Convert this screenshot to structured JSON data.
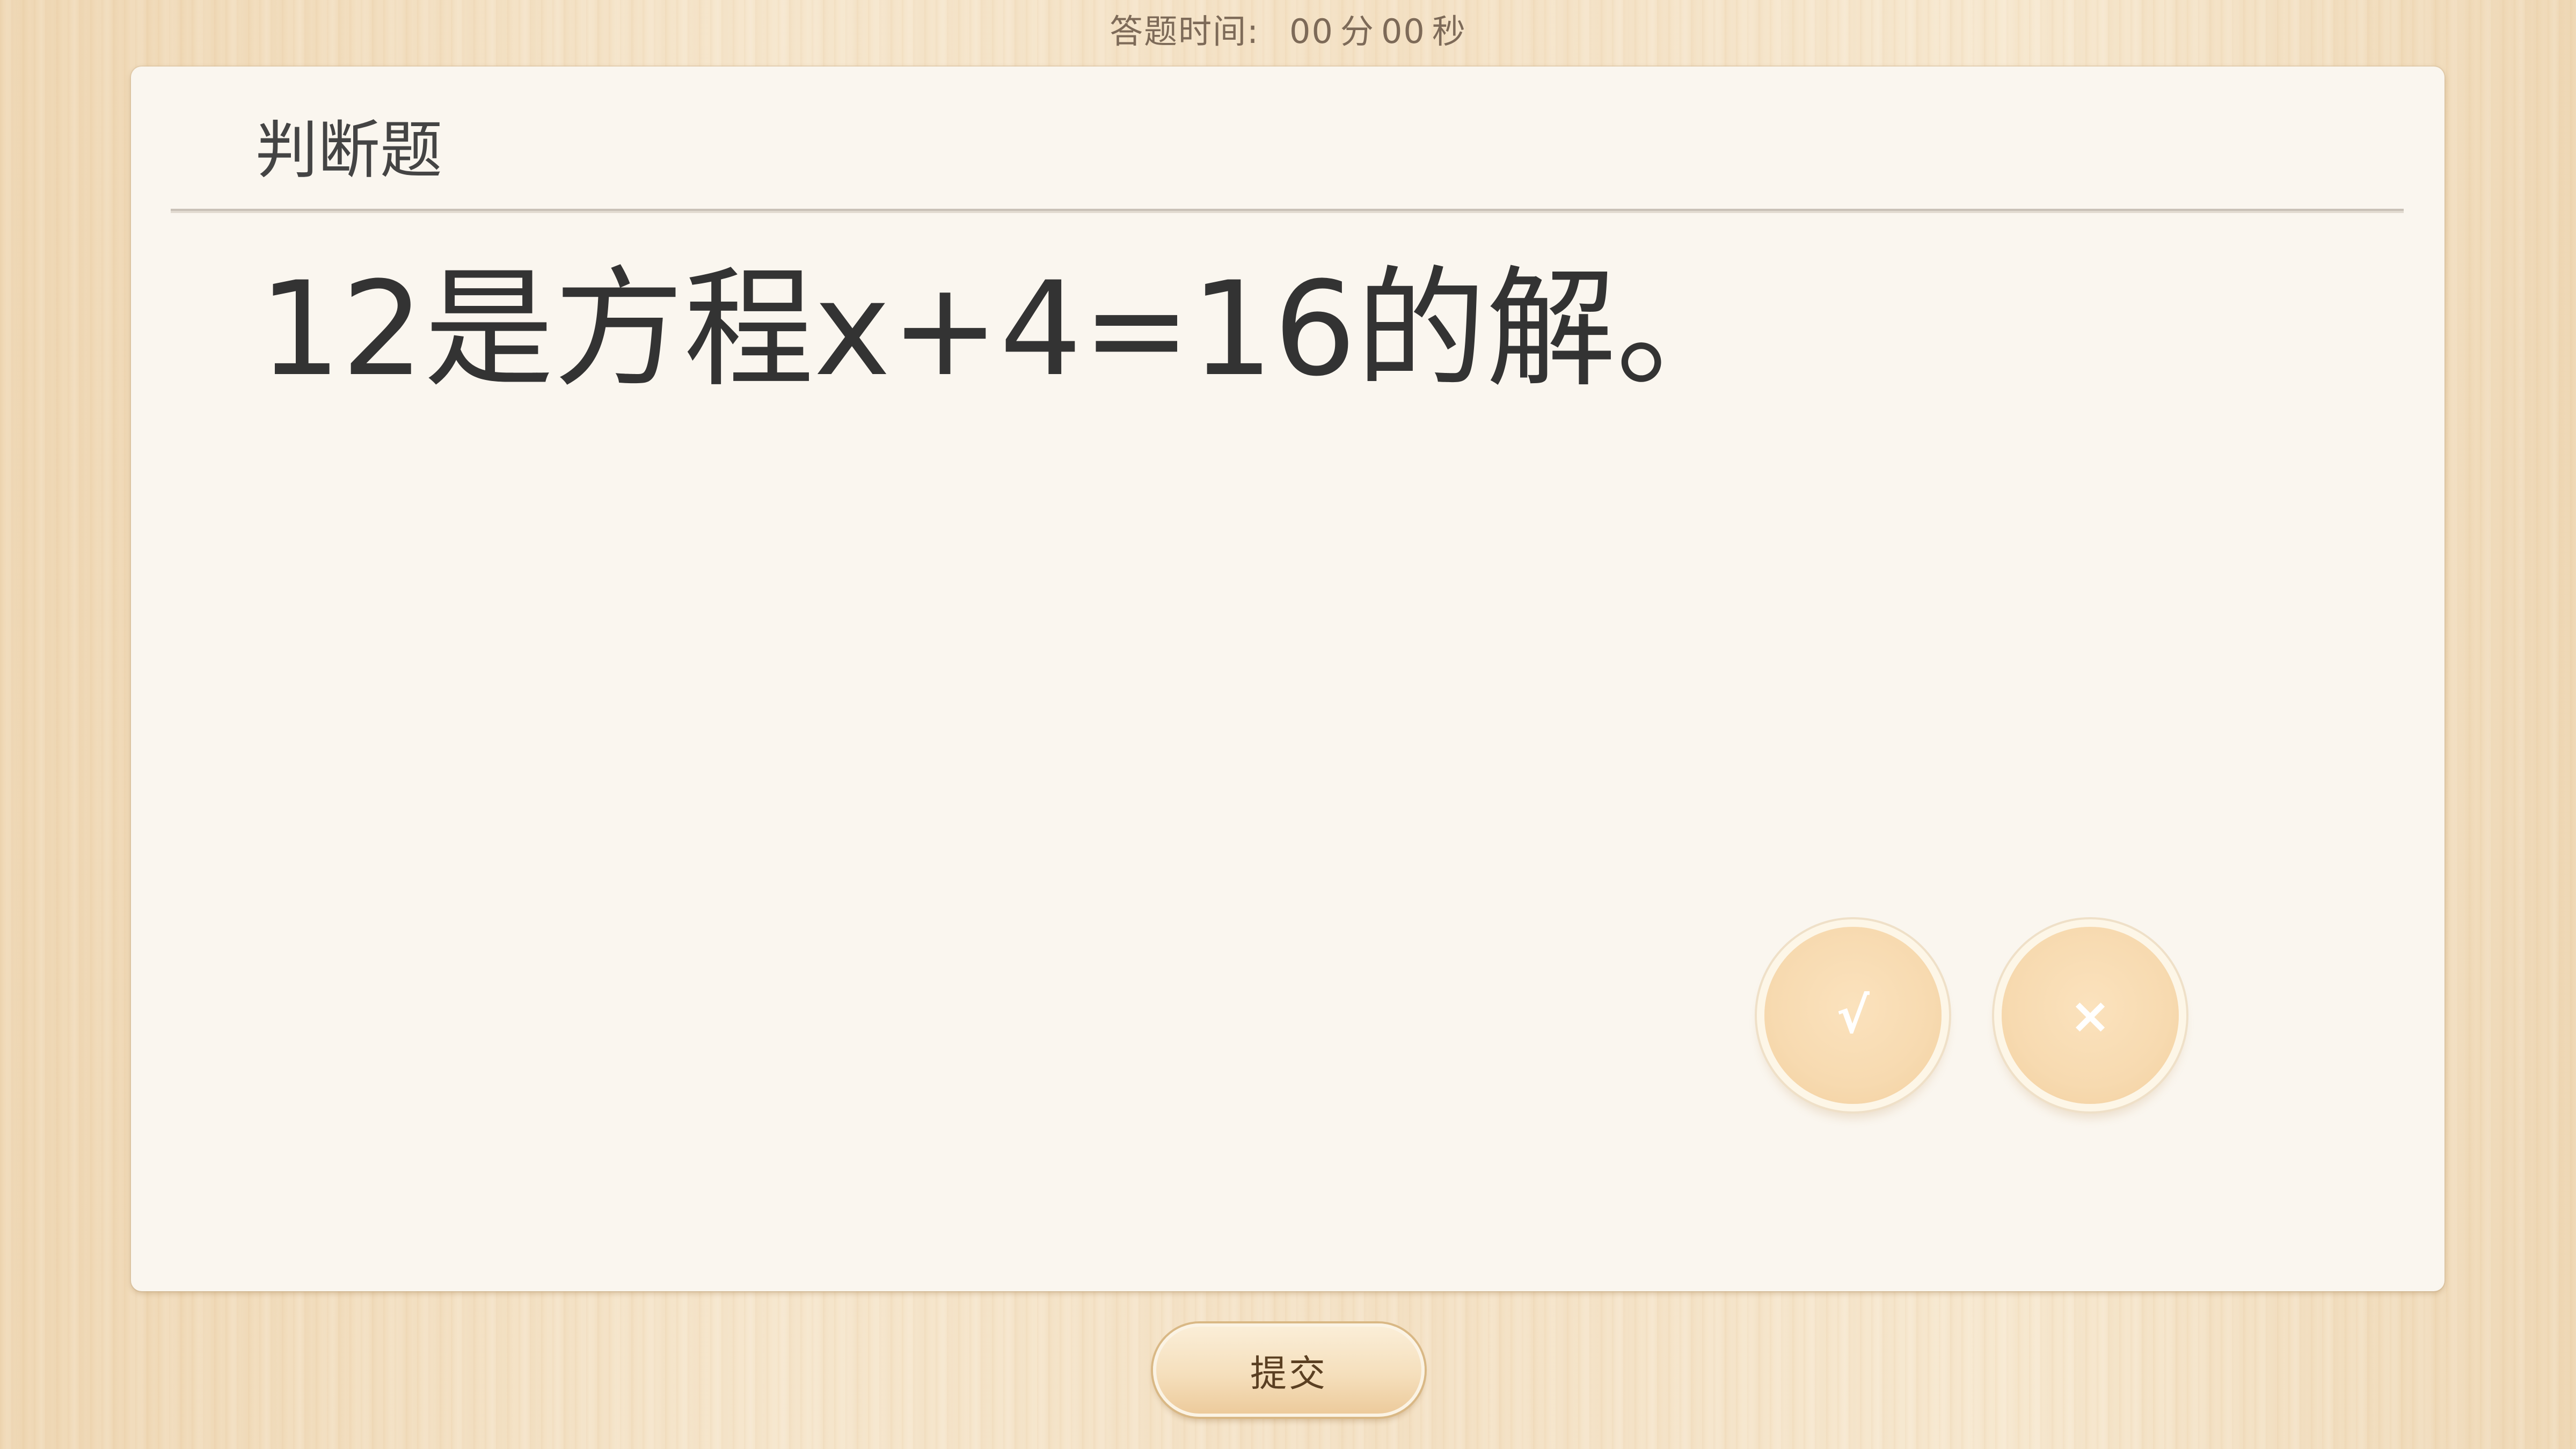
{
  "timer": {
    "label": "答题时间:",
    "minutes": "00",
    "minutes_unit": "分",
    "seconds": "00",
    "seconds_unit": "秒"
  },
  "card": {
    "title": "判断题",
    "question": "12是方程x+4=16的解。"
  },
  "answers": {
    "true_label": "√",
    "false_label": "×"
  },
  "submit_label": "提交",
  "colors": {
    "background": "#f3dfc1",
    "card": "#faf6ef",
    "answer_button": "#f7dab0",
    "submit_button": "#f5dfbc",
    "text": "#333333"
  }
}
